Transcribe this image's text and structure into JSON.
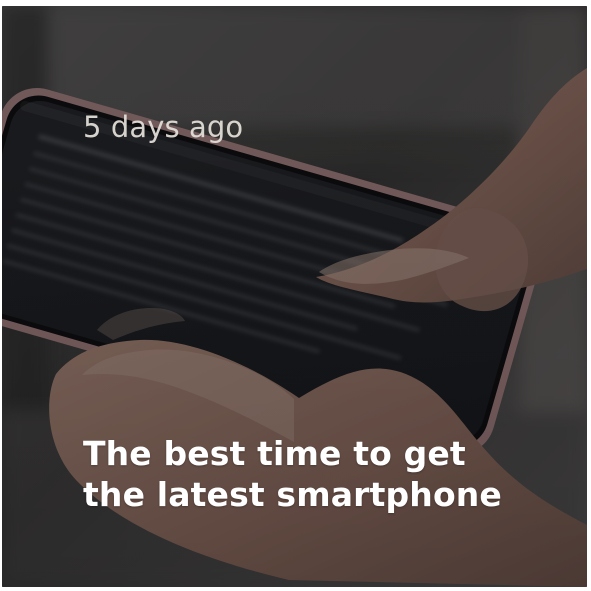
{
  "card": {
    "timestamp": "5 days ago",
    "title": "The best time to get the latest smartphone"
  },
  "image": {
    "semantic": "hands holding a smartphone and tapping the screen"
  }
}
